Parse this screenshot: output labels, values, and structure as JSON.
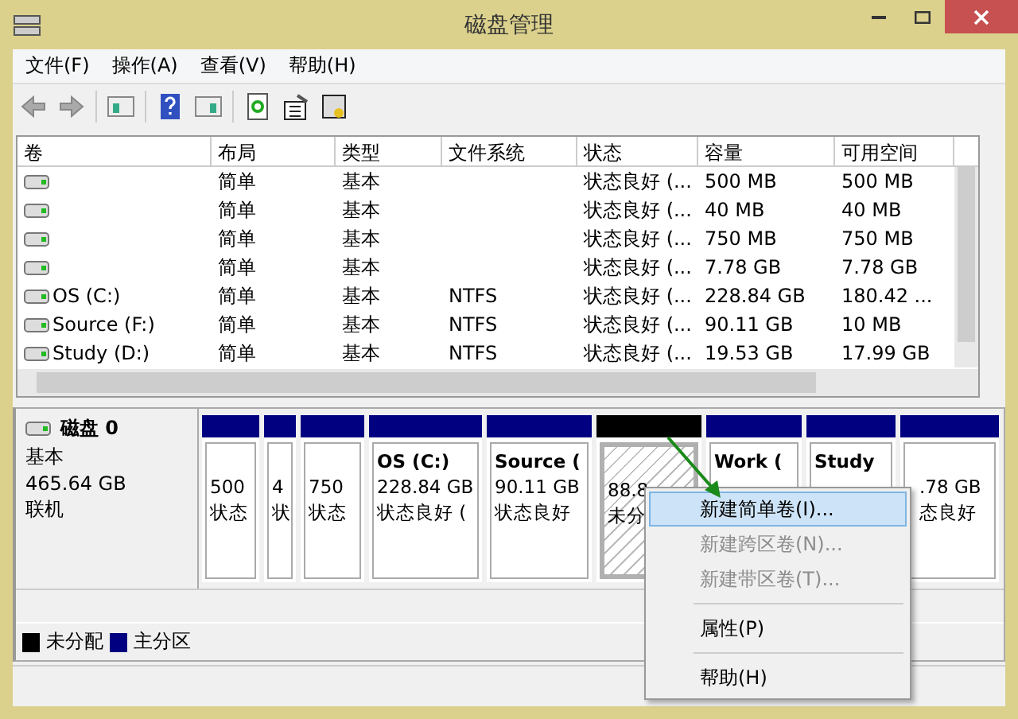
{
  "window": {
    "title": "磁盘管理"
  },
  "menu": [
    "文件(F)",
    "操作(A)",
    "查看(V)",
    "帮助(H)"
  ],
  "table": {
    "columns": [
      "卷",
      "布局",
      "类型",
      "文件系统",
      "状态",
      "容量",
      "可用空间"
    ],
    "rows": [
      {
        "cells": [
          "",
          "简单",
          "基本",
          "",
          "状态良好 (...",
          "500 MB",
          "500 MB"
        ]
      },
      {
        "cells": [
          "",
          "简单",
          "基本",
          "",
          "状态良好 (...",
          "40 MB",
          "40 MB"
        ]
      },
      {
        "cells": [
          "",
          "简单",
          "基本",
          "",
          "状态良好 (...",
          "750 MB",
          "750 MB"
        ]
      },
      {
        "cells": [
          "",
          "简单",
          "基本",
          "",
          "状态良好 (...",
          "7.78 GB",
          "7.78 GB"
        ]
      },
      {
        "cells": [
          "OS (C:)",
          "简单",
          "基本",
          "NTFS",
          "状态良好 (...",
          "228.84 GB",
          "180.42 ..."
        ]
      },
      {
        "cells": [
          "Source (F:)",
          "简单",
          "基本",
          "NTFS",
          "状态良好 (...",
          "90.11 GB",
          "10 MB"
        ]
      },
      {
        "cells": [
          "Study (D:)",
          "简单",
          "基本",
          "NTFS",
          "状态良好 (...",
          "19.53 GB",
          "17.99 GB"
        ]
      }
    ]
  },
  "disk": {
    "name": "磁盘 0",
    "type": "基本",
    "size": "465.64 GB",
    "status": "联机",
    "partitions": [
      {
        "kind": "primary",
        "selected": false,
        "lines": [
          "500",
          "状态"
        ]
      },
      {
        "kind": "primary",
        "selected": false,
        "lines": [
          "4",
          "状"
        ]
      },
      {
        "kind": "primary",
        "selected": false,
        "lines": [
          "750",
          "状态"
        ]
      },
      {
        "kind": "primary",
        "selected": false,
        "title": "OS (C:)",
        "lines": [
          "228.84 GB",
          "状态良好 ("
        ]
      },
      {
        "kind": "primary",
        "selected": false,
        "title": "Source (",
        "lines": [
          "90.11 GB",
          "状态良好"
        ]
      },
      {
        "kind": "unallocated",
        "selected": true,
        "lines": [
          "88.8",
          "未分"
        ]
      },
      {
        "kind": "primary",
        "selected": false,
        "title": "Work ("
      },
      {
        "kind": "primary",
        "selected": false,
        "title": "Study"
      },
      {
        "kind": "primary",
        "selected": false,
        "lines": [
          ".78 GB",
          "态良好"
        ]
      }
    ]
  },
  "legend": [
    {
      "label": "未分配",
      "color": "#000000"
    },
    {
      "label": "主分区",
      "color": "#000080"
    }
  ],
  "context_menu": [
    {
      "kind": "item",
      "label": "新建简单卷(I)...",
      "selected": true,
      "disabled": false
    },
    {
      "kind": "item",
      "label": "新建跨区卷(N)...",
      "selected": false,
      "disabled": true
    },
    {
      "kind": "item",
      "label": "新建带区卷(T)...",
      "selected": false,
      "disabled": true
    },
    {
      "kind": "separator"
    },
    {
      "kind": "item",
      "label": "属性(P)",
      "selected": false,
      "disabled": false
    },
    {
      "kind": "separator"
    },
    {
      "kind": "item",
      "label": "帮助(H)",
      "selected": false,
      "disabled": false
    }
  ]
}
